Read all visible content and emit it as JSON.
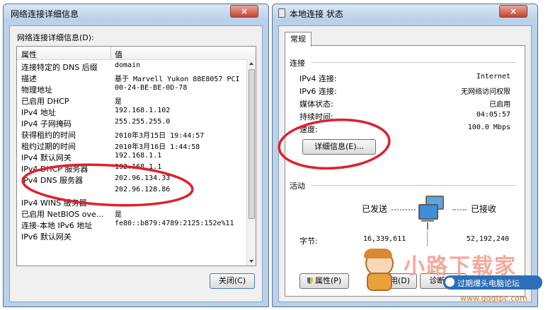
{
  "details": {
    "title": "网络连接详细信息",
    "close_x": "×",
    "list_label": "网络连接详细信息(D):",
    "col_property": "属性",
    "col_value": "值",
    "rows": [
      {
        "p": "连接特定的 DNS 后缀",
        "v": "domain"
      },
      {
        "p": "描述",
        "v": "基于 Marvell Yukon 88E8057 PCI"
      },
      {
        "p": "物理地址",
        "v": "00-24-BE-BE-0D-78"
      },
      {
        "p": "已启用 DHCP",
        "v": "是"
      },
      {
        "p": "IPv4 地址",
        "v": "192.168.1.102"
      },
      {
        "p": "IPv4 子网掩码",
        "v": "255.255.255.0"
      },
      {
        "p": "获得租约的时间",
        "v": "2010年3月15日 19:44:57"
      },
      {
        "p": "租约过期的时间",
        "v": "2010年3月16日 1:44:58"
      },
      {
        "p": "IPv4 默认网关",
        "v": "192.168.1.1"
      },
      {
        "p": "IPv4 DHCP 服务器",
        "v": "192.168.1.1"
      },
      {
        "p": "IPv4 DNS 服务器",
        "v": "202.96.134.33"
      },
      {
        "p": "",
        "v": "202.96.128.86"
      },
      {
        "p": "IPv4 WINS 服务器",
        "v": ""
      },
      {
        "p": "已启用 NetBIOS ove...",
        "v": "是"
      },
      {
        "p": "连接-本地 IPv6 地址",
        "v": "fe80::b879:4789:2125:152e%11"
      },
      {
        "p": "IPv6 默认网关",
        "v": ""
      }
    ],
    "close_button": "关闭(C)"
  },
  "status": {
    "title": "本地连接 状态",
    "close_x": "×",
    "tab": "常规",
    "section_connection": "连接",
    "fields": [
      {
        "label": "IPv4 连接:",
        "value": "Internet"
      },
      {
        "label": "IPv6 连接:",
        "value": "无网络访问权限"
      },
      {
        "label": "媒体状态:",
        "value": "已启用"
      },
      {
        "label": "持续时间:",
        "value": "04:05:57"
      },
      {
        "label": "速度:",
        "value": "100.0 Mbps"
      }
    ],
    "details_button": "详细信息(E)...",
    "section_activity": "活动",
    "sent_label": "已发送",
    "received_label": "已接收",
    "bytes_label": "字节:",
    "bytes_sent": "16,339,611",
    "bytes_received": "52,192,240",
    "btn_properties": "属性(P)",
    "btn_disable": "禁用(D)",
    "btn_diagnose": "诊断(G)"
  },
  "watermark": {
    "brand": "小路下载家",
    "forum": "过期爆头电脑论坛",
    "url": "www.gqgtpc.com"
  },
  "colors": {
    "annotation_red": "#e0202a",
    "title_bar": "#c9dcf0",
    "close_red": "#c4432f"
  }
}
